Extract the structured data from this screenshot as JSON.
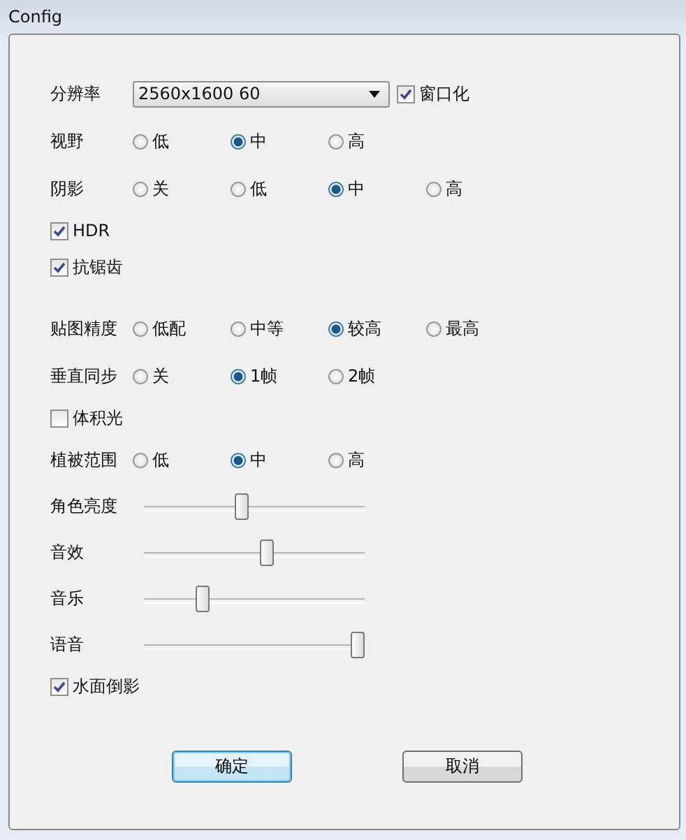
{
  "window": {
    "title": "Config"
  },
  "sections": [
    {
      "rows": [
        {
          "kind": "dropdown",
          "label": "分辨率",
          "value": "2560x1600 60",
          "check": {
            "label": "窗口化",
            "checked": true
          }
        },
        {
          "kind": "radio",
          "label": "视野",
          "options": [
            {
              "label": "低",
              "selected": false
            },
            {
              "label": "中",
              "selected": true
            },
            {
              "label": "高",
              "selected": false
            }
          ]
        },
        {
          "kind": "radio",
          "label": "阴影",
          "options": [
            {
              "label": "关",
              "selected": false
            },
            {
              "label": "低",
              "selected": false
            },
            {
              "label": "中",
              "selected": true
            },
            {
              "label": "高",
              "selected": false
            }
          ]
        },
        {
          "kind": "checkbox",
          "label": "HDR",
          "checked": true
        },
        {
          "kind": "checkbox",
          "label": "抗锯齿",
          "checked": true
        }
      ]
    },
    {
      "rows": [
        {
          "kind": "radio",
          "label": "贴图精度",
          "options": [
            {
              "label": "低配",
              "selected": false
            },
            {
              "label": "中等",
              "selected": false
            },
            {
              "label": "较高",
              "selected": true
            },
            {
              "label": "最高",
              "selected": false
            }
          ]
        },
        {
          "kind": "radio",
          "label": "垂直同步",
          "options": [
            {
              "label": "关",
              "selected": false
            },
            {
              "label": "1帧",
              "selected": true
            },
            {
              "label": "2帧",
              "selected": false
            }
          ]
        },
        {
          "kind": "checkbox",
          "label": "体积光",
          "checked": false
        },
        {
          "kind": "radio",
          "label": "植被范围",
          "options": [
            {
              "label": "低",
              "selected": false
            },
            {
              "label": "中",
              "selected": true
            },
            {
              "label": "高",
              "selected": false
            }
          ]
        },
        {
          "kind": "slider",
          "label": "角色亮度",
          "level": 0.44
        },
        {
          "kind": "slider",
          "label": "音效",
          "level": 0.56
        },
        {
          "kind": "slider",
          "label": "音乐",
          "level": 0.25
        },
        {
          "kind": "slider",
          "label": "语音",
          "level": 1.0
        },
        {
          "kind": "checkbox",
          "label": "水面倒影",
          "checked": true
        }
      ]
    }
  ],
  "buttons": [
    {
      "label": "确定",
      "default": true
    },
    {
      "label": "取消",
      "default": false
    }
  ]
}
